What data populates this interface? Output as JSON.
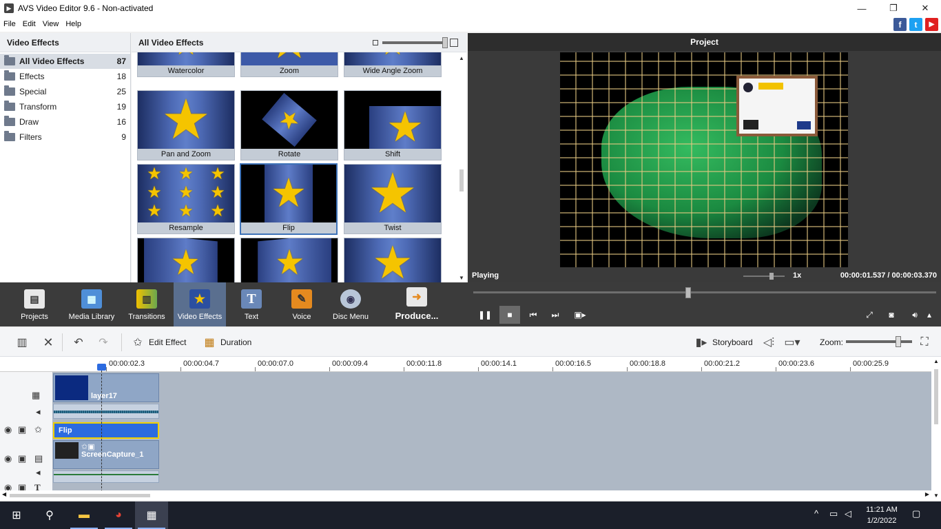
{
  "window": {
    "title": "AVS Video Editor 9.6 - Non-activated",
    "minimize": "—",
    "maximize": "❐",
    "close": "✕"
  },
  "menu": [
    "File",
    "Edit",
    "View",
    "Help"
  ],
  "social": {
    "facebook": "f",
    "twitter": "t",
    "youtube": "▶"
  },
  "left_panel": {
    "title": "Video Effects",
    "categories": [
      {
        "name": "All Video Effects",
        "count": "87",
        "selected": true
      },
      {
        "name": "Effects",
        "count": "18"
      },
      {
        "name": "Special",
        "count": "25"
      },
      {
        "name": "Transform",
        "count": "19"
      },
      {
        "name": "Draw",
        "count": "16"
      },
      {
        "name": "Filters",
        "count": "9"
      }
    ]
  },
  "effects_panel": {
    "title": "All Video Effects",
    "tiles": [
      "Watercolor",
      "Zoom",
      "Wide Angle Zoom",
      "Pan and Zoom",
      "Rotate",
      "Shift",
      "Resample",
      "Flip",
      "Twist"
    ],
    "selected_tile": "Flip"
  },
  "preview": {
    "title": "Project",
    "status": "Playing",
    "speed": "1x",
    "current_time": "00:00:01.537",
    "separator": "/",
    "total_time": "00:00:03.370"
  },
  "main_toolbar": {
    "projects": "Projects",
    "media_library": "Media Library",
    "transitions": "Transitions",
    "video_effects": "Video Effects",
    "text": "Text",
    "voice": "Voice",
    "disc_menu": "Disc Menu",
    "produce": "Produce..."
  },
  "timeline_toolbar": {
    "edit_effect": "Edit Effect",
    "duration": "Duration",
    "storyboard": "Storyboard",
    "zoom": "Zoom:"
  },
  "ruler": [
    "00:00:02.3",
    "00:00:04.7",
    "00:00:07.0",
    "00:00:09.4",
    "00:00:11.8",
    "00:00:14.1",
    "00:00:16.5",
    "00:00:18.8",
    "00:00:21.2",
    "00:00:23.6",
    "00:00:25.9"
  ],
  "timeline": {
    "video_clip": "layer17",
    "effect_clip": "Flip",
    "screen_clip": "ScreenCapture_1"
  },
  "taskbar": {
    "time": "11:21 AM",
    "date": "1/2/2022"
  },
  "colors": {
    "accent": "#2c6be0",
    "selected_tool": "#5a6f8f",
    "effect_border": "#f2d000"
  }
}
